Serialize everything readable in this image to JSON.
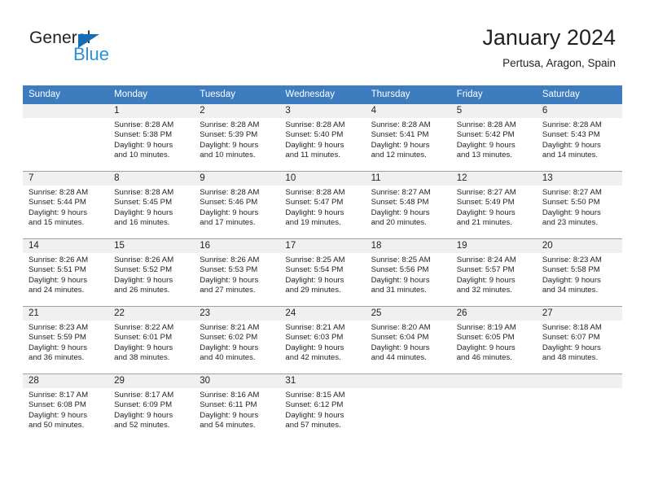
{
  "branding": {
    "logo_text_primary": "General",
    "logo_text_secondary": "Blue",
    "logo_triangle_color": "#176db5",
    "logo_secondary_color": "#2a90d8"
  },
  "header": {
    "title": "January 2024",
    "subtitle": "Pertusa, Aragon, Spain"
  },
  "theme": {
    "header_bg": "#3c7cbf",
    "header_text": "#ffffff",
    "daynum_band_bg": "#f0f0f0",
    "grid_line": "#9fa2a4",
    "body_text": "#231f20"
  },
  "calendar": {
    "weekday_headers": [
      "Sunday",
      "Monday",
      "Tuesday",
      "Wednesday",
      "Thursday",
      "Friday",
      "Saturday"
    ],
    "weeks": [
      [
        {
          "day": "",
          "lines": []
        },
        {
          "day": "1",
          "lines": [
            "Sunrise: 8:28 AM",
            "Sunset: 5:38 PM",
            "Daylight: 9 hours",
            "and 10 minutes."
          ]
        },
        {
          "day": "2",
          "lines": [
            "Sunrise: 8:28 AM",
            "Sunset: 5:39 PM",
            "Daylight: 9 hours",
            "and 10 minutes."
          ]
        },
        {
          "day": "3",
          "lines": [
            "Sunrise: 8:28 AM",
            "Sunset: 5:40 PM",
            "Daylight: 9 hours",
            "and 11 minutes."
          ]
        },
        {
          "day": "4",
          "lines": [
            "Sunrise: 8:28 AM",
            "Sunset: 5:41 PM",
            "Daylight: 9 hours",
            "and 12 minutes."
          ]
        },
        {
          "day": "5",
          "lines": [
            "Sunrise: 8:28 AM",
            "Sunset: 5:42 PM",
            "Daylight: 9 hours",
            "and 13 minutes."
          ]
        },
        {
          "day": "6",
          "lines": [
            "Sunrise: 8:28 AM",
            "Sunset: 5:43 PM",
            "Daylight: 9 hours",
            "and 14 minutes."
          ]
        }
      ],
      [
        {
          "day": "7",
          "lines": [
            "Sunrise: 8:28 AM",
            "Sunset: 5:44 PM",
            "Daylight: 9 hours",
            "and 15 minutes."
          ]
        },
        {
          "day": "8",
          "lines": [
            "Sunrise: 8:28 AM",
            "Sunset: 5:45 PM",
            "Daylight: 9 hours",
            "and 16 minutes."
          ]
        },
        {
          "day": "9",
          "lines": [
            "Sunrise: 8:28 AM",
            "Sunset: 5:46 PM",
            "Daylight: 9 hours",
            "and 17 minutes."
          ]
        },
        {
          "day": "10",
          "lines": [
            "Sunrise: 8:28 AM",
            "Sunset: 5:47 PM",
            "Daylight: 9 hours",
            "and 19 minutes."
          ]
        },
        {
          "day": "11",
          "lines": [
            "Sunrise: 8:27 AM",
            "Sunset: 5:48 PM",
            "Daylight: 9 hours",
            "and 20 minutes."
          ]
        },
        {
          "day": "12",
          "lines": [
            "Sunrise: 8:27 AM",
            "Sunset: 5:49 PM",
            "Daylight: 9 hours",
            "and 21 minutes."
          ]
        },
        {
          "day": "13",
          "lines": [
            "Sunrise: 8:27 AM",
            "Sunset: 5:50 PM",
            "Daylight: 9 hours",
            "and 23 minutes."
          ]
        }
      ],
      [
        {
          "day": "14",
          "lines": [
            "Sunrise: 8:26 AM",
            "Sunset: 5:51 PM",
            "Daylight: 9 hours",
            "and 24 minutes."
          ]
        },
        {
          "day": "15",
          "lines": [
            "Sunrise: 8:26 AM",
            "Sunset: 5:52 PM",
            "Daylight: 9 hours",
            "and 26 minutes."
          ]
        },
        {
          "day": "16",
          "lines": [
            "Sunrise: 8:26 AM",
            "Sunset: 5:53 PM",
            "Daylight: 9 hours",
            "and 27 minutes."
          ]
        },
        {
          "day": "17",
          "lines": [
            "Sunrise: 8:25 AM",
            "Sunset: 5:54 PM",
            "Daylight: 9 hours",
            "and 29 minutes."
          ]
        },
        {
          "day": "18",
          "lines": [
            "Sunrise: 8:25 AM",
            "Sunset: 5:56 PM",
            "Daylight: 9 hours",
            "and 31 minutes."
          ]
        },
        {
          "day": "19",
          "lines": [
            "Sunrise: 8:24 AM",
            "Sunset: 5:57 PM",
            "Daylight: 9 hours",
            "and 32 minutes."
          ]
        },
        {
          "day": "20",
          "lines": [
            "Sunrise: 8:23 AM",
            "Sunset: 5:58 PM",
            "Daylight: 9 hours",
            "and 34 minutes."
          ]
        }
      ],
      [
        {
          "day": "21",
          "lines": [
            "Sunrise: 8:23 AM",
            "Sunset: 5:59 PM",
            "Daylight: 9 hours",
            "and 36 minutes."
          ]
        },
        {
          "day": "22",
          "lines": [
            "Sunrise: 8:22 AM",
            "Sunset: 6:01 PM",
            "Daylight: 9 hours",
            "and 38 minutes."
          ]
        },
        {
          "day": "23",
          "lines": [
            "Sunrise: 8:21 AM",
            "Sunset: 6:02 PM",
            "Daylight: 9 hours",
            "and 40 minutes."
          ]
        },
        {
          "day": "24",
          "lines": [
            "Sunrise: 8:21 AM",
            "Sunset: 6:03 PM",
            "Daylight: 9 hours",
            "and 42 minutes."
          ]
        },
        {
          "day": "25",
          "lines": [
            "Sunrise: 8:20 AM",
            "Sunset: 6:04 PM",
            "Daylight: 9 hours",
            "and 44 minutes."
          ]
        },
        {
          "day": "26",
          "lines": [
            "Sunrise: 8:19 AM",
            "Sunset: 6:05 PM",
            "Daylight: 9 hours",
            "and 46 minutes."
          ]
        },
        {
          "day": "27",
          "lines": [
            "Sunrise: 8:18 AM",
            "Sunset: 6:07 PM",
            "Daylight: 9 hours",
            "and 48 minutes."
          ]
        }
      ],
      [
        {
          "day": "28",
          "lines": [
            "Sunrise: 8:17 AM",
            "Sunset: 6:08 PM",
            "Daylight: 9 hours",
            "and 50 minutes."
          ]
        },
        {
          "day": "29",
          "lines": [
            "Sunrise: 8:17 AM",
            "Sunset: 6:09 PM",
            "Daylight: 9 hours",
            "and 52 minutes."
          ]
        },
        {
          "day": "30",
          "lines": [
            "Sunrise: 8:16 AM",
            "Sunset: 6:11 PM",
            "Daylight: 9 hours",
            "and 54 minutes."
          ]
        },
        {
          "day": "31",
          "lines": [
            "Sunrise: 8:15 AM",
            "Sunset: 6:12 PM",
            "Daylight: 9 hours",
            "and 57 minutes."
          ]
        },
        {
          "day": "",
          "lines": []
        },
        {
          "day": "",
          "lines": []
        },
        {
          "day": "",
          "lines": []
        }
      ]
    ]
  }
}
